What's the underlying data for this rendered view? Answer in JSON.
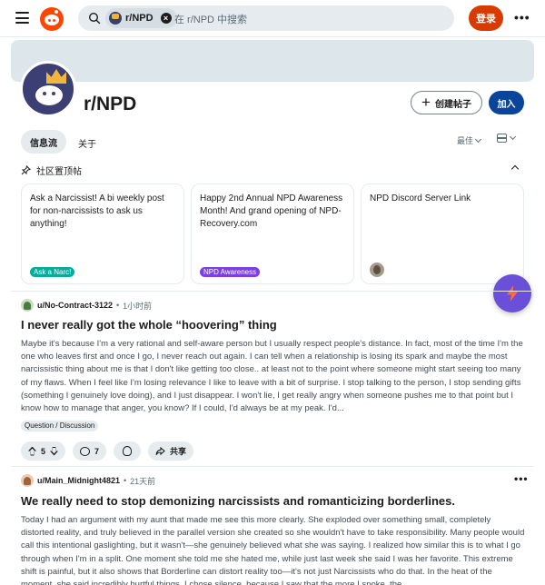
{
  "topbar": {
    "search_chip": "r/NPD",
    "search_placeholder": "在 r/NPD 中搜索",
    "login_label": "登录",
    "more_label": "•••"
  },
  "community": {
    "name": "r/NPD",
    "create_post_label": "创建帖子",
    "join_label": "加入"
  },
  "tabs": {
    "feed": "信息流",
    "about": "关于",
    "sort": "最佳"
  },
  "pinned": {
    "header": "社区置顶帖",
    "cards": [
      {
        "title": "Ask a Narcissist! A bi weekly post for non-narcissists to ask us anything!",
        "flair": "Ask a Narc!",
        "flair_color": "#0aa89e"
      },
      {
        "title": "Happy 2nd Annual NPD Awareness Month! And grand opening of NPD-Recovery.com",
        "flair": "NPD Awareness",
        "flair_color": "#7e3ee0"
      },
      {
        "title": "NPD Discord Server Link",
        "flair": "",
        "flair_color": ""
      }
    ]
  },
  "posts": [
    {
      "user": "u/No-Contract-3122",
      "time": "1小时前",
      "title": "I never really got the whole “hoovering” thing",
      "body": "Maybe it's because I'm a very rational and self-aware person but I usually respect people's distance. In fact, most of the time I'm the one who leaves first and once I go, I never reach out again. I can tell when a relationship is losing its spark and maybe the most narcissistic thing about me is that I don't like getting too close.. at least not to the point where someone might start seeing too many of my flaws. When I feel like I'm losing relevance I like to leave with a bit of surprise. I stop talking to the person, I stop sending gifts (something I genuinely love doing), and I just disappear. I won't lie, I get really angry when someone pushes me to that point but I know how to manage that anger, you know? If I could, I'd always be at my peak. I'd...",
      "flair": "Question / Discussion",
      "votes": "5",
      "comments": "7",
      "share_label": "共享"
    },
    {
      "user": "u/Main_Midnight4821",
      "time": "21天前",
      "title": "We really need to stop demonizing narcissists and romanticizing borderlines.",
      "body": "Today I had an argument with my aunt that made me see this more clearly. She exploded over something small, completely distorted reality, and truly believed in the parallel version she created so she wouldn't have to take responsibility. Many people would call this intentional gaslighting, but it wasn't—she genuinely believed what she was saying. I realized how similar this is to what I go through when I'm in a split. One moment she told me she hated me, while just last week she said I was her favorite. This extreme shift is painful, but it also shows that Borderline can distort reality too—it's not just Narcissists who do that. In the heat of the moment, she said incredibly hurtful things. I chose silence, because I saw that the more I spoke, the"
    }
  ],
  "colors": {
    "brand": "#ff4500",
    "login": "#d93a00",
    "join": "#0a449b",
    "fab": "#6a4fd8"
  }
}
